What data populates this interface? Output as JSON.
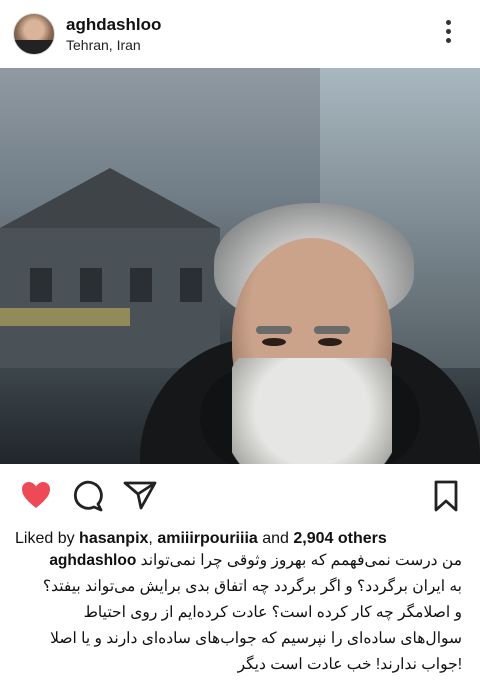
{
  "post": {
    "username": "aghdashloo",
    "location": "Tehran, Iran"
  },
  "likes": {
    "prefix": "Liked by",
    "user1": "hasanpix",
    "separator": ",",
    "user2": "amiiirpouriiia",
    "and": "and",
    "others": "2,904 others"
  },
  "caption": {
    "author": "aghdashloo",
    "line1": "من درست نمی‌فهمم که بهروز وثوقی چرا نمی‌تواند",
    "line2": "به ایران برگردد؟ و اگر برگردد چه اتفاق بدی برایش می‌تواند بیفتد؟",
    "line3": "و اصلا‌مگر چه کار کرده است؟ عادت کرده‌ایم از روی احتیاط",
    "line4": "سوال‌های ساده‌ای را نپرسیم که جواب‌های ساده‌ای دارند و یا اصلا",
    "line5": "!جواب ندارند! خب عادت است دیگر"
  },
  "colors": {
    "heart": "#ed4956",
    "text": "#111111"
  },
  "icons": [
    "heart-icon",
    "comment-icon",
    "share-icon",
    "bookmark-icon",
    "more-options-icon"
  ]
}
